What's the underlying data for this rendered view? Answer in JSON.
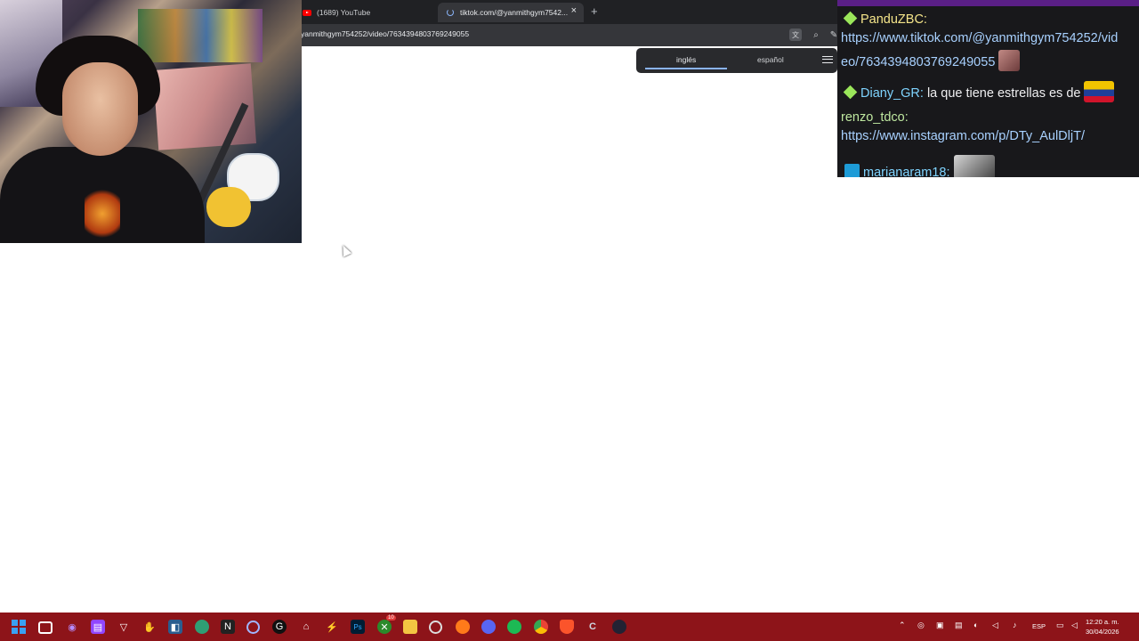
{
  "browser": {
    "tabs": [
      {
        "title": "(1689) YouTube"
      },
      {
        "title": "tiktok.com/@yanmithgym7542..."
      }
    ],
    "new_tab_glyph": "+",
    "close_glyph": "×",
    "url": "yanmithgym754252/video/7634394803769249055"
  },
  "translate_popup": {
    "source_lang": "inglés",
    "target_lang": "español"
  },
  "chat": {
    "messages": [
      {
        "user": "PanduZBC:",
        "text": "https://www.tiktok.com/@yanmithgym754252/vid",
        "text2": "eo/7634394803769249055"
      },
      {
        "user": "Diany_GR:",
        "text": "la que tiene estrellas es de"
      },
      {
        "user": "renzo_tdco:",
        "text": "https://www.instagram.com/p/DTy_AulDljT/"
      },
      {
        "user": "marianaram18:"
      }
    ]
  },
  "taskbar": {
    "icons": [
      "windows-start",
      "terminal",
      "obs",
      "twitch",
      "app",
      "app",
      "app",
      "edge",
      "app",
      "app",
      "app",
      "app",
      "app",
      "photoshop",
      "xbox",
      "file-explorer",
      "chrome-dev",
      "firefox",
      "discord",
      "spotify",
      "chrome",
      "brave",
      "app",
      "app"
    ],
    "xbox_badge": "10",
    "lang": "ESP",
    "time": "12:20 a. m.",
    "date": "30/04/2026"
  }
}
